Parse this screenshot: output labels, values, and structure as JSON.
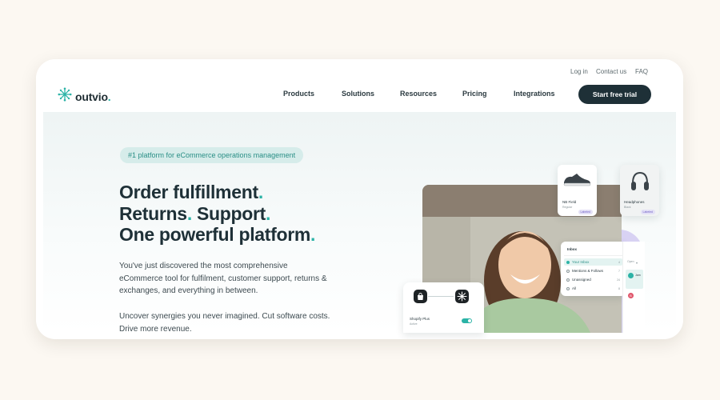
{
  "util_links": [
    "Log in",
    "Contact us",
    "FAQ"
  ],
  "brand": {
    "name": "outvio",
    "dot": "."
  },
  "nav": [
    "Products",
    "Solutions",
    "Resources",
    "Pricing",
    "Integrations"
  ],
  "cta": "Start free trial",
  "hero": {
    "badge": "#1 platform for eCommerce operations management",
    "headline": [
      {
        "text": "Order fulfillment",
        "dot": "."
      },
      {
        "text": "Returns",
        "dot": ".",
        "text2": " Support",
        "dot2": "."
      },
      {
        "text": "One powerful platform",
        "dot": "."
      }
    ],
    "paragraph1": "You've just discovered the most comprehensive eCommerce tool for fulfilment, customer support, returns & exchanges, and everything in between.",
    "paragraph2": "Uncover synergies you never imagined. Cut software costs. Drive more revenue."
  },
  "mockup": {
    "product1": {
      "name": "NB Field",
      "sub": "Regular",
      "tag": "Labeled"
    },
    "product2": {
      "name": "Headphones",
      "sub": "Black",
      "tag": "Labeled"
    },
    "inbox": {
      "title": "Inbox",
      "open_label": "Open",
      "items": [
        {
          "label": "Your Inbox",
          "count": "4"
        },
        {
          "label": "Mentions & Follows",
          "count": "7"
        },
        {
          "label": "Unassigned",
          "count": "24"
        },
        {
          "label": "All",
          "count": "8"
        }
      ],
      "chat_initial": "Jam",
      "chat_badge": "B"
    },
    "integration": {
      "name": "Shopify Plus",
      "status": "Active"
    }
  },
  "colors": {
    "accent": "#2bb3a6",
    "dark": "#1e3037",
    "badge_bg": "#d6ecea",
    "page_bg": "#fcf8f2"
  }
}
